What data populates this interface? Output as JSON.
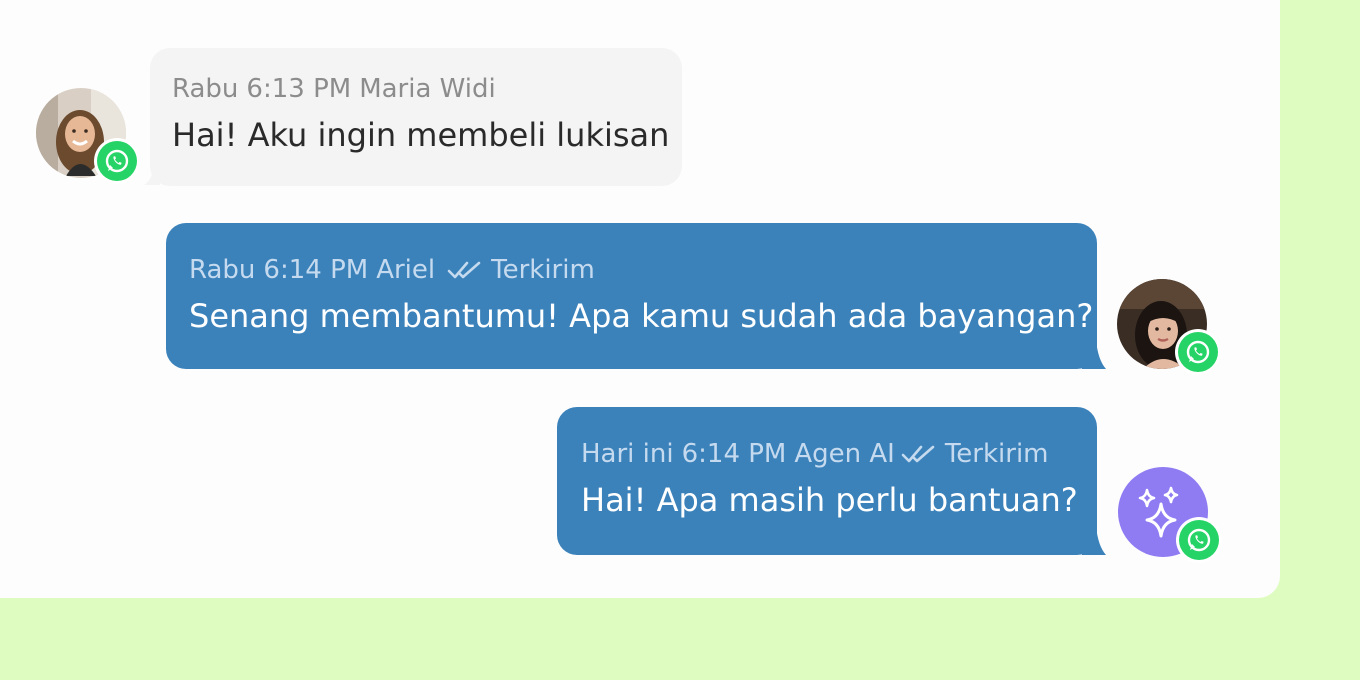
{
  "colors": {
    "page_bg": "#dffcc0",
    "panel_bg": "#fdfdfd",
    "incoming_bubble": "#f4f4f4",
    "outgoing_bubble": "#3b82bb",
    "whatsapp": "#25d366",
    "ai_avatar": "#8f7cf3"
  },
  "messages": [
    {
      "direction": "incoming",
      "day": "Rabu",
      "time": "6:13 PM",
      "sender": "Maria Widi",
      "text": "Hai! Aku ingin membeli lukisan",
      "channel_icon": "whatsapp-icon",
      "avatar": "user-photo"
    },
    {
      "direction": "outgoing",
      "day": "Rabu",
      "time": "6:14 PM",
      "sender": "Ariel",
      "status": "Terkirim",
      "status_icon": "double-check-icon",
      "text": "Senang membantumu! Apa kamu sudah ada bayangan?",
      "channel_icon": "whatsapp-icon",
      "avatar": "agent-photo"
    },
    {
      "direction": "outgoing",
      "day": "Hari ini",
      "time": "6:14 PM",
      "sender": "Agen AI",
      "status": "Terkirim",
      "status_icon": "double-check-icon",
      "text": "Hai! Apa masih perlu bantuan?",
      "channel_icon": "whatsapp-icon",
      "avatar": "sparkles-icon"
    }
  ]
}
